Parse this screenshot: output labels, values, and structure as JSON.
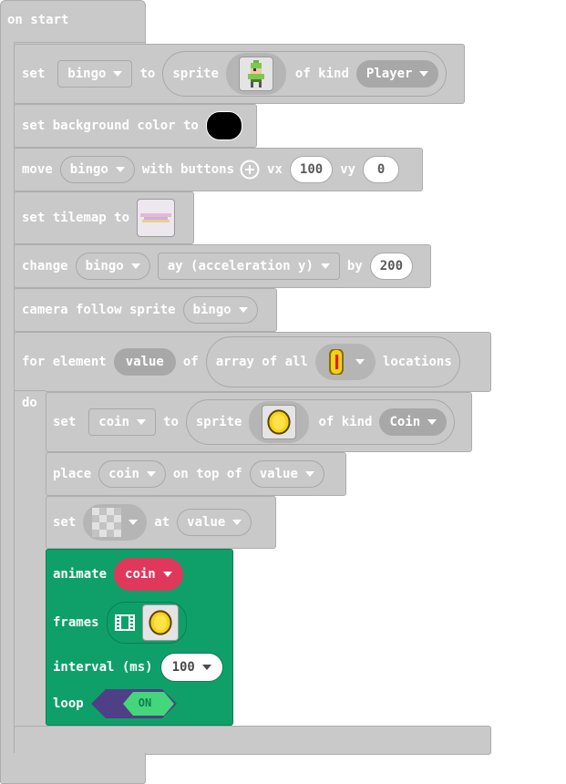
{
  "on_start": {
    "label": "on start"
  },
  "set_bingo": {
    "set": "set",
    "var": "bingo",
    "to": "to",
    "sprite": "sprite",
    "of_kind": "of kind",
    "kind": "Player"
  },
  "background": {
    "label": "set background color to",
    "color": "#000000"
  },
  "move": {
    "label": "move",
    "var": "bingo",
    "with_buttons": "with buttons",
    "vx_label": "vx",
    "vx": "100",
    "vy_label": "vy",
    "vy": "0"
  },
  "tilemap": {
    "label": "set tilemap to"
  },
  "change": {
    "label": "change",
    "var": "bingo",
    "property": "ay (acceleration y)",
    "by": "by",
    "value": "200"
  },
  "camera": {
    "label": "camera follow sprite",
    "var": "bingo"
  },
  "for_element": {
    "label": "for element",
    "var": "value",
    "of": "of",
    "array_label": "array of all",
    "locations": "locations",
    "do": "do"
  },
  "set_coin": {
    "set": "set",
    "var": "coin",
    "to": "to",
    "sprite": "sprite",
    "of_kind": "of kind",
    "kind": "Coin"
  },
  "place": {
    "label": "place",
    "var": "coin",
    "on_top_of": "on top of",
    "target": "value"
  },
  "set_tile": {
    "label": "set",
    "at": "at",
    "target": "value"
  },
  "animate": {
    "label": "animate",
    "var": "coin",
    "frames": "frames",
    "interval": "interval (ms)",
    "interval_value": "100",
    "loop": "loop",
    "loop_state": "ON",
    "green": "#0fa06a",
    "var_color": "#e0385a",
    "toggle_color": "#4f3f86"
  }
}
